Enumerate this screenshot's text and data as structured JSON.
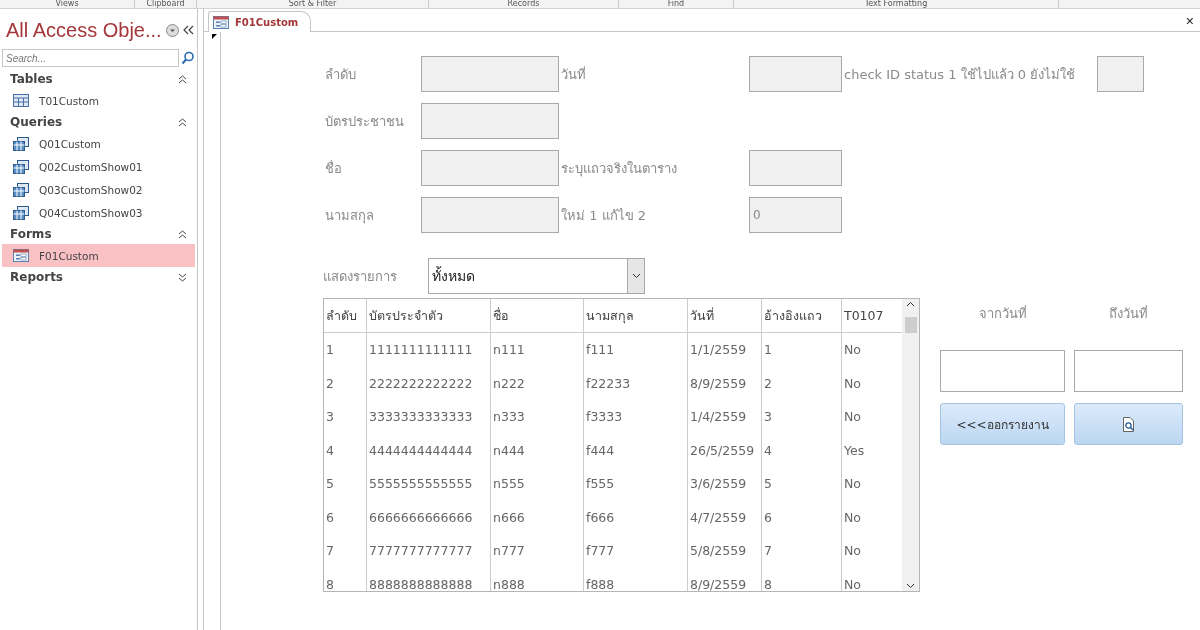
{
  "ribbon_groups": [
    "Views",
    "Clipboard",
    "Sort & Filter",
    "Records",
    "Find",
    "Text Formatting"
  ],
  "nav": {
    "title": "All Access Obje...",
    "search_placeholder": "Search...",
    "groups": [
      {
        "name": "Tables",
        "expanded": true,
        "items": [
          {
            "label": "T01Custom",
            "kind": "table",
            "selected": false
          }
        ]
      },
      {
        "name": "Queries",
        "expanded": true,
        "items": [
          {
            "label": "Q01Custom",
            "kind": "query",
            "selected": false
          },
          {
            "label": "Q02CustomShow01",
            "kind": "query",
            "selected": false
          },
          {
            "label": "Q03CustomShow02",
            "kind": "query",
            "selected": false
          },
          {
            "label": "Q04CustomShow03",
            "kind": "query",
            "selected": false
          }
        ]
      },
      {
        "name": "Forms",
        "expanded": true,
        "items": [
          {
            "label": "F01Custom",
            "kind": "form",
            "selected": true
          }
        ]
      },
      {
        "name": "Reports",
        "expanded": false
      }
    ]
  },
  "document_tab": {
    "label": "F01Custom",
    "close": "×"
  },
  "form_rows": [
    [
      {
        "label": "ลำดับ"
      },
      {
        "label": "วันที่"
      },
      {
        "label": "check ID status 1 ใช้ไปแล้ว 0 ยังไม่ใช้"
      }
    ],
    [
      {
        "label": "บัตรประชาชน"
      }
    ],
    [
      {
        "label": "ชื่อ"
      },
      {
        "label": "ระบุแถวจริงในตาราง"
      }
    ],
    [
      {
        "label": "นามสกุล"
      },
      {
        "label": "ใหม่ 1 แก้ไข 2",
        "value": "0"
      }
    ]
  ],
  "list_filter": {
    "label": "แสดงรายการ",
    "value": "ทั้งหมด"
  },
  "table": {
    "columns": [
      "ลำดับ",
      "บัตรประจำตัว",
      "ชื่อ",
      "นามสกุล",
      "วันที่",
      "อ้างอิงแถว",
      "T0107"
    ],
    "rows": [
      [
        "1",
        "1111111111111",
        "n111",
        "f111",
        "1/1/2559",
        "1",
        "No"
      ],
      [
        "2",
        "2222222222222",
        "n222",
        "f22233",
        "8/9/2559",
        "2",
        "No"
      ],
      [
        "3",
        "3333333333333",
        "n333",
        "f3333",
        "1/4/2559",
        "3",
        "No"
      ],
      [
        "4",
        "4444444444444",
        "n444",
        "f444",
        "26/5/2559",
        "4",
        "Yes"
      ],
      [
        "5",
        "5555555555555",
        "n555",
        "f555",
        "3/6/2559",
        "5",
        "No"
      ],
      [
        "6",
        "6666666666666",
        "n666",
        "f666",
        "4/7/2559",
        "6",
        "No"
      ],
      [
        "7",
        "7777777777777",
        "n777",
        "f777",
        "5/8/2559",
        "7",
        "No"
      ],
      [
        "8",
        "8888888888888",
        "n888",
        "f888",
        "8/9/2559",
        "8",
        "No"
      ]
    ]
  },
  "date_range": {
    "from_label": "จากวันที่",
    "to_label": "ถึงวันที่",
    "report_button": "<<<ออกรายงาน"
  }
}
